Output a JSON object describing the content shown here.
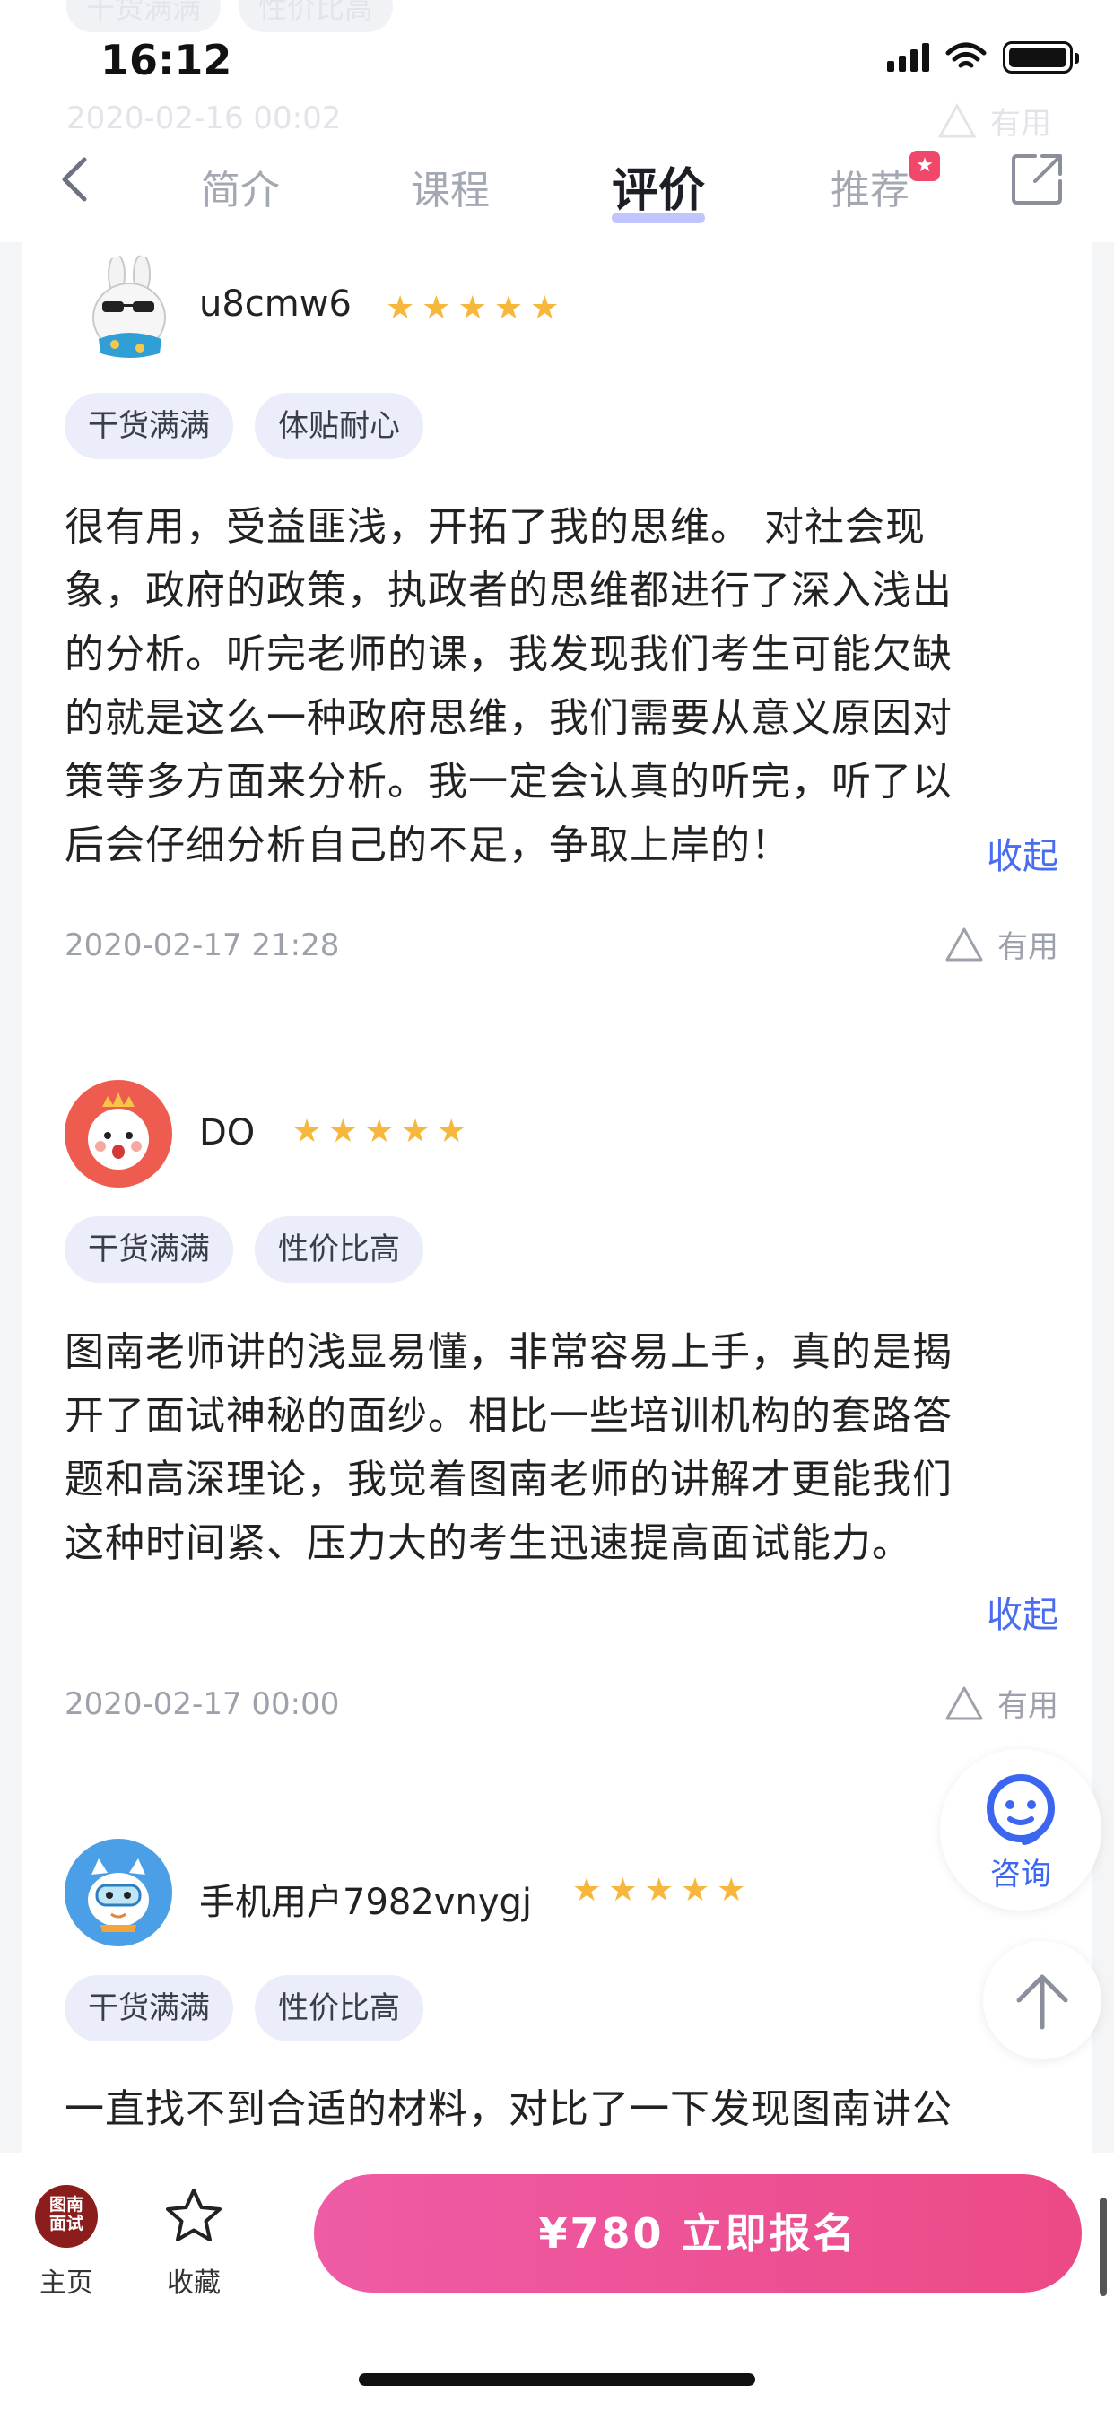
{
  "status_bar": {
    "time": "16:12"
  },
  "ghost_top": {
    "tags": [
      "干货满满",
      "性价比高"
    ],
    "date": "2020-02-16 00:02",
    "useful": "有用"
  },
  "nav": {
    "tabs": [
      {
        "label": "简介",
        "active": false
      },
      {
        "label": "课程",
        "active": false
      },
      {
        "label": "评价",
        "active": true
      },
      {
        "label": "推荐",
        "active": false
      }
    ]
  },
  "reviews": [
    {
      "username": "u8cmw6",
      "rating": 5,
      "tags": [
        "干货满满",
        "体贴耐心"
      ],
      "lines": [
        "很有用，受益匪浅，开拓了我的思维。 对社会现",
        "象，政府的政策，执政者的思维都进行了深入浅出",
        "的分析。听完老师的课，我发现我们考生可能欠缺",
        "的就是这么一种政府思维，我们需要从意义原因对",
        "策等多方面来分析。我一定会认真的听完，听了以",
        "后会仔细分析自己的不足，争取上岸的！"
      ],
      "collapse": "收起",
      "date": "2020-02-17 21:28",
      "useful": "有用"
    },
    {
      "username": "DO",
      "rating": 5,
      "tags": [
        "干货满满",
        "性价比高"
      ],
      "lines": [
        "图南老师讲的浅显易懂，非常容易上手，真的是揭",
        "开了面试神秘的面纱。相比一些培训机构的套路答",
        "题和高深理论，我觉着图南老师的讲解才更能我们",
        "这种时间紧、压力大的考生迅速提高面试能力。"
      ],
      "collapse": "收起",
      "date": "2020-02-17 00:00",
      "useful": "有用"
    },
    {
      "username": "手机用户7982vnygj",
      "rating": 5,
      "tags": [
        "干货满满",
        "性价比高"
      ],
      "lines": [
        "一直找不到合适的材料，对比了一下发现图南讲公"
      ]
    }
  ],
  "floating": {
    "consult_label": "咨询"
  },
  "bottom_bar": {
    "home_logo": "图南\n面试",
    "home_label": "主页",
    "fav_label": "收藏",
    "enroll_label": "¥780  立即报名"
  },
  "colors": {
    "accent": "#4a6cf0",
    "star": "#f6b73c",
    "enroll_start": "#ef5ba6",
    "enroll_end": "#ec4a86"
  }
}
